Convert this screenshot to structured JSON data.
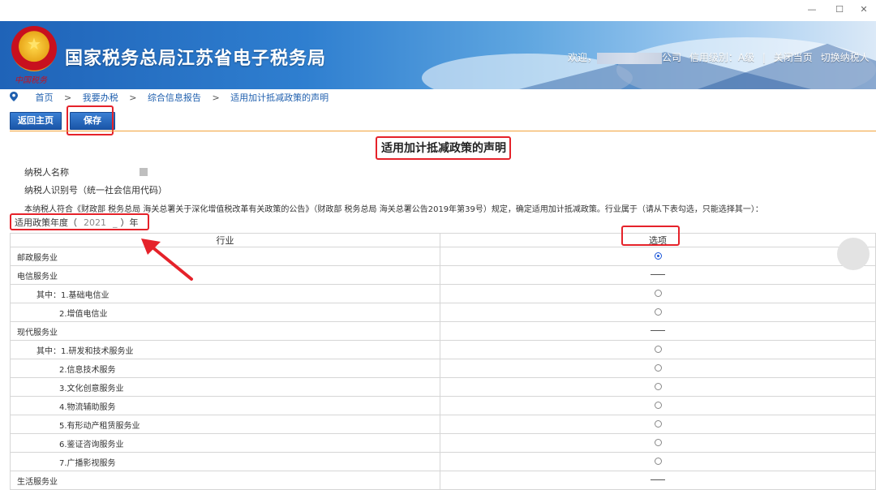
{
  "window": {
    "minimize": "—",
    "maximize": "☐",
    "close": "✕"
  },
  "banner": {
    "emblem_motto": "中国税务",
    "title": "国家税务总局江苏省电子税务局",
    "user_prefix": "欢迎，",
    "user_suffix": "公司",
    "credit_label": "信用级别：A级",
    "separator": "|",
    "close_page": "关闭当页",
    "switch_taxpayer": "切换纳税人"
  },
  "breadcrumb": {
    "items": [
      "首页",
      "我要办税",
      "综合信息报告"
    ],
    "separator": ">",
    "current": "适用加计抵减政策的声明"
  },
  "toolbar": {
    "home_label": "返回主页",
    "save_label": "保存"
  },
  "form": {
    "title": "适用加计抵减政策的声明",
    "taxpayer_name_label": "纳税人名称",
    "taxpayer_id_label": "纳税人识别号（统一社会信用代码）",
    "statement": "本纳税人符合《财政部 税务总局 海关总署关于深化增值税改革有关政策的公告》（财政部 税务总局 海关总署公告2019年第39号）规定，确定适用加计抵减政策。行业属于（请从下表勾选，只能选择其一）：",
    "year_label": "适用政策年度（",
    "year_value": "2021",
    "year_suffix": "）年"
  },
  "table": {
    "headers": {
      "industry": "行业",
      "option": "选项"
    },
    "rows": [
      {
        "label": "邮政服务业",
        "indent": 0,
        "control": "radio",
        "checked": true
      },
      {
        "label": "电信服务业",
        "indent": 0,
        "control": "dash",
        "checked": false
      },
      {
        "label": "其中：1.基础电信业",
        "indent": 1,
        "control": "radio",
        "checked": false
      },
      {
        "label": "2.增值电信业",
        "indent": 2,
        "control": "radio",
        "checked": false
      },
      {
        "label": "现代服务业",
        "indent": 0,
        "control": "dash",
        "checked": false
      },
      {
        "label": "其中：1.研发和技术服务业",
        "indent": 1,
        "control": "radio",
        "checked": false
      },
      {
        "label": "2.信息技术服务",
        "indent": 2,
        "control": "radio",
        "checked": false
      },
      {
        "label": "3.文化创意服务业",
        "indent": 2,
        "control": "radio",
        "checked": false
      },
      {
        "label": "4.物流辅助服务",
        "indent": 2,
        "control": "radio",
        "checked": false
      },
      {
        "label": "5.有形动产租赁服务业",
        "indent": 2,
        "control": "radio",
        "checked": false
      },
      {
        "label": "6.鉴证咨询服务业",
        "indent": 2,
        "control": "radio",
        "checked": false
      },
      {
        "label": "7.广播影视服务",
        "indent": 2,
        "control": "radio",
        "checked": false
      },
      {
        "label": "生活服务业",
        "indent": 0,
        "control": "dash",
        "checked": false
      }
    ]
  },
  "colors": {
    "accent_blue": "#1a56a8",
    "highlight_red": "#e5222a",
    "rule_orange": "#f2a23a"
  }
}
